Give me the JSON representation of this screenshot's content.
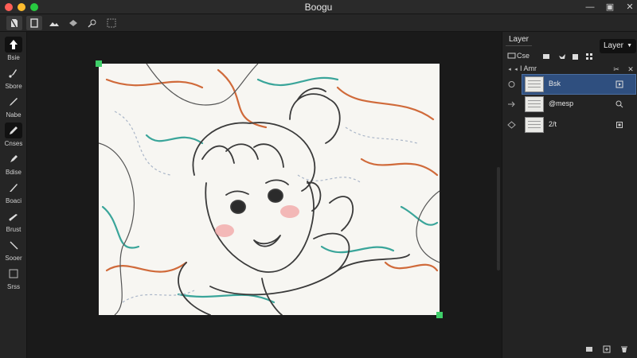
{
  "window": {
    "title": "Boogu"
  },
  "tools": [
    {
      "label": "Bsie",
      "icon": "move-arrow-icon"
    },
    {
      "label": "Sbore",
      "icon": "brush-icon"
    },
    {
      "label": "Nabe",
      "icon": "pen-icon"
    },
    {
      "label": "Cnses",
      "icon": "pencil-icon"
    },
    {
      "label": "Bdise",
      "icon": "marker-icon"
    },
    {
      "label": "Boaci",
      "icon": "knife-icon"
    },
    {
      "label": "Brust",
      "icon": "airbrush-icon"
    },
    {
      "label": "Sooer",
      "icon": "smudge-icon"
    },
    {
      "label": "Srss",
      "icon": "eraser-icon"
    }
  ],
  "panel": {
    "tab": "Layer",
    "dropdown": "Layer",
    "row1_label": "Cse",
    "row2_label": "I Amr",
    "layers": [
      {
        "name": "Bsk",
        "selected": true
      },
      {
        "name": "@mesp",
        "selected": false
      },
      {
        "name": "2/t",
        "selected": false
      }
    ]
  },
  "colors": {
    "accent_select": "#2f4f7f",
    "handle": "#3fcf6a"
  }
}
